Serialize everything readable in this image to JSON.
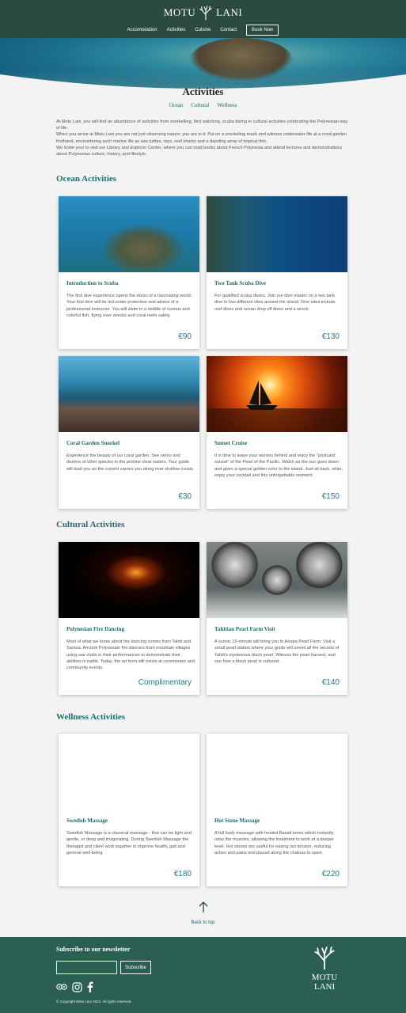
{
  "header": {
    "logo_text_left": "MOTU",
    "logo_text_right": "LANI",
    "nav": [
      "Accomodation",
      "Activities",
      "Cuisine",
      "Contact"
    ],
    "book_label": "Book Now"
  },
  "page": {
    "title": "Activities",
    "tabs": [
      "Ocean",
      "Cultural",
      "Wellness"
    ],
    "intro": "At Motu Lani, you will find an abundance of activities from snorkelling, bird watching, scuba diving to cultural activities celebrating the Polynesian way of life.\nWhen you arrive at Motu Lani you are not just observing nature; you are in it. Put on a snorkeling mask and witness underwater life at a coral garden firsthand, encountering such marine life as sea turtles, rays, reef sharks and a dazzling array of tropical fish.\nWe invite your to visit our Library and Explorer Center, where you can read books about French Polynesia and attend lectures and demonstrations about Polynesian culture, history, and lifestyle."
  },
  "sections": {
    "ocean": "Ocean Activities",
    "cultural": "Cultural Activities",
    "wellness": "Wellness Activities"
  },
  "cards": [
    {
      "title": "Introduction to Scuba",
      "desc": "The first dive experience opens the doors of a fascinating world. Your first dive will be led under protection and advice of a professional instructor. You will swim in a middle of curious and colorful fish, flying over wrecks and coral reefs safely.",
      "price": "€90"
    },
    {
      "title": "Two Tank Scuba Dive",
      "desc": "For qualified scuba divers. Join our dive master on a two tank dive to two different sites around the island. Dive sites include reef dives and ocean drop off dives and a wreck.",
      "price": "€130"
    },
    {
      "title": "Coral Garden Snorkel",
      "desc": "Experience the beauty of our coral garden. See nemo and dozens of other species in the pristine clear waters. Your guide will lead you as the current carries you along over shallow corals.",
      "price": "€30"
    },
    {
      "title": "Sunset Cruise",
      "desc": "It is time to leave your worries behind and enjoy the \"postcard sunset\" of the Pearl of the Pacific. Watch as the sun goes down and gives a special golden color to the island. Just sit back, relax, enjoy your cocktail and this unforgettable moment.",
      "price": "€150"
    },
    {
      "title": "Polynesian Fire Dancing",
      "desc": "Most of what we know about fire dancing comes from Tahiti and Samoa. Ancient Polynesian fire dancers from mountain villages using war clubs in their performances to demonstrate their abilities in battle. Today, the art form still exists at ceremonies and community events.",
      "price": "Complimentary"
    },
    {
      "title": "Tahitian Pearl Farm Visit",
      "desc": "A scenic 15-minute will bring you to Anapa Pearl Farm. Visit a small pearl station where your guide will unveil all the secrets of Tahiti's mysterious black pearl. Witness the pearl harvest, and see how a black pearl is cultured.",
      "price": "€140"
    },
    {
      "title": "Swedish Massage",
      "desc": "Swedish Massage is a classical massage - that can be light and gentle, or deep and invigorating. During Swedish Massage the therapist and client work together to improve health, gait and general well-being.",
      "price": "€180"
    },
    {
      "title": "Hot Stone Massage",
      "desc": "A full body massage with heated Basalt tones which instantly relax the muscles, allowing the treatment to work at a deeper level. Hot stones are useful for easing out tension, reducing aches and pains and placed along the chakras to open.",
      "price": "€220"
    }
  ],
  "back_to_top": "Back to top",
  "footer": {
    "subscribe_heading": "Subscribe to our newsletter",
    "subscribe_button": "Subscribe",
    "copyright": "© Copyright Motu Lani 2022. All rights reserved.",
    "logo_left": "MOTU",
    "logo_right": "LANI"
  },
  "colors": {
    "header_bg": "#2b4a42",
    "accent": "#1f6b6b",
    "price": "#1f7b8a",
    "footer_bg": "#2b5f53",
    "page_bg": "#f3f3f3"
  },
  "icons": [
    "coral-logo-icon",
    "tripadvisor-icon",
    "instagram-icon",
    "facebook-icon",
    "arrow-up-icon"
  ]
}
